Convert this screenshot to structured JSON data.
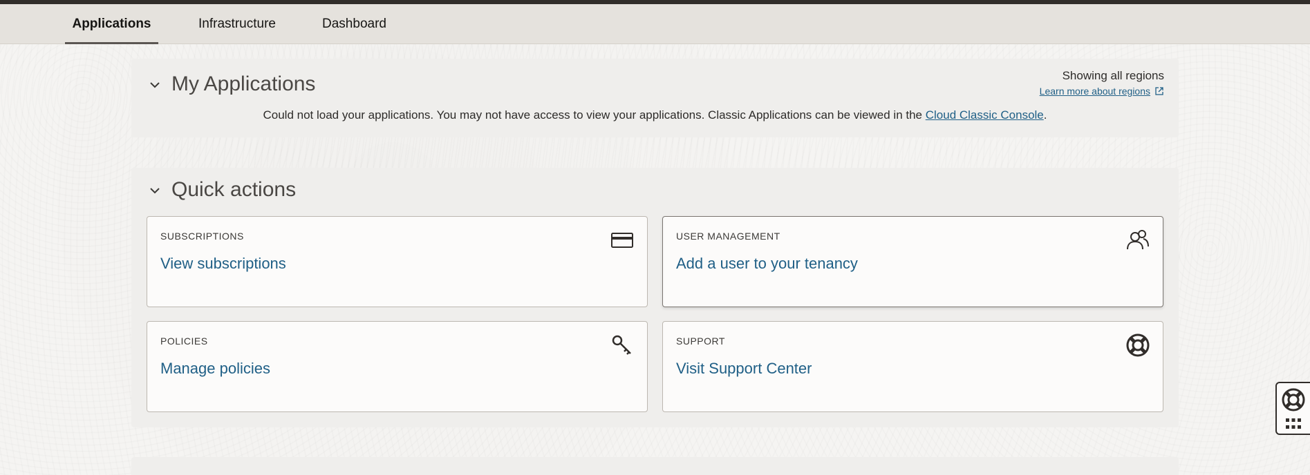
{
  "tabs": [
    {
      "label": "Applications",
      "active": true
    },
    {
      "label": "Infrastructure",
      "active": false
    },
    {
      "label": "Dashboard",
      "active": false
    }
  ],
  "my_applications": {
    "title": "My Applications",
    "showing_regions": "Showing all regions",
    "learn_more": "Learn more about regions",
    "message_prefix": "Could not load your applications. You may not have access to view your applications. Classic Applications can be viewed in the ",
    "message_link": "Cloud Classic Console",
    "message_suffix": "."
  },
  "quick_actions": {
    "title": "Quick actions",
    "cards": [
      {
        "category": "SUBSCRIPTIONS",
        "link": "View subscriptions",
        "icon": "credit-card-icon"
      },
      {
        "category": "USER MANAGEMENT",
        "link": "Add a user to your tenancy",
        "icon": "users-icon"
      },
      {
        "category": "POLICIES",
        "link": "Manage policies",
        "icon": "key-icon"
      },
      {
        "category": "SUPPORT",
        "link": "Visit Support Center",
        "icon": "lifebuoy-icon"
      }
    ]
  },
  "colors": {
    "link": "#1f5f86",
    "tabbar": "#e5e2dd",
    "panel": "#efeeec",
    "text": "#161513"
  },
  "floating_widget": {
    "icons": [
      "lifebuoy-icon",
      "grid-icon"
    ]
  }
}
